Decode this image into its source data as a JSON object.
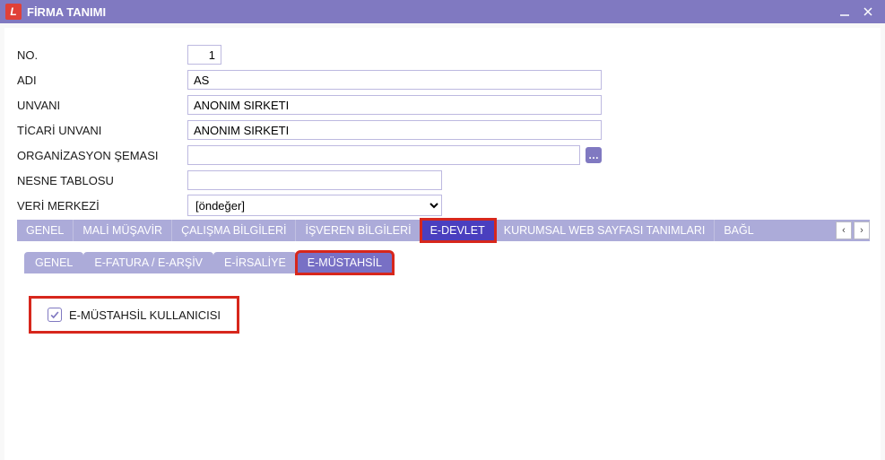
{
  "window": {
    "title": "FİRMA TANIMI",
    "icon_letter": "L"
  },
  "form": {
    "no_label": "NO.",
    "no_value": "1",
    "adi_label": "ADI",
    "adi_value": "AS",
    "unvani_label": "UNVANI",
    "unvani_value": "ANONIM SIRKETI",
    "ticari_unvani_label": "TİCARİ UNVANI",
    "ticari_unvani_value": "ANONIM SIRKETI",
    "org_sema_label": "ORGANİZASYON ŞEMASI",
    "org_sema_value": "",
    "nesne_tablosu_label": "NESNE TABLOSU",
    "nesne_tablosu_value": "",
    "veri_merkezi_label": "VERİ MERKEZİ",
    "veri_merkezi_value": "[öndeğer]",
    "org_btn_glyph": "…",
    "org_btn_name": "ellipsis-icon"
  },
  "tabs": {
    "items": [
      {
        "label": "GENEL"
      },
      {
        "label": "MALİ MÜŞAVİR"
      },
      {
        "label": "ÇALIŞMA BİLGİLERİ"
      },
      {
        "label": "İŞVEREN BİLGİLERİ"
      },
      {
        "label": "E-DEVLET"
      },
      {
        "label": "KURUMSAL WEB SAYFASI TANIMLARI"
      },
      {
        "label": "BAĞL"
      }
    ],
    "scroll_left": "‹",
    "scroll_right": "›"
  },
  "subtabs": {
    "items": [
      {
        "label": "GENEL"
      },
      {
        "label": "E-FATURA / E-ARŞİV"
      },
      {
        "label": "E-İRSALİYE"
      },
      {
        "label": "E-MÜSTAHSİL"
      }
    ]
  },
  "checkbox": {
    "label": "E-MÜSTAHSİL KULLANICISI",
    "checked": true
  },
  "colors": {
    "accent": "#8079c1",
    "active_tab": "#4a3fbf",
    "highlight": "#d7271c"
  }
}
